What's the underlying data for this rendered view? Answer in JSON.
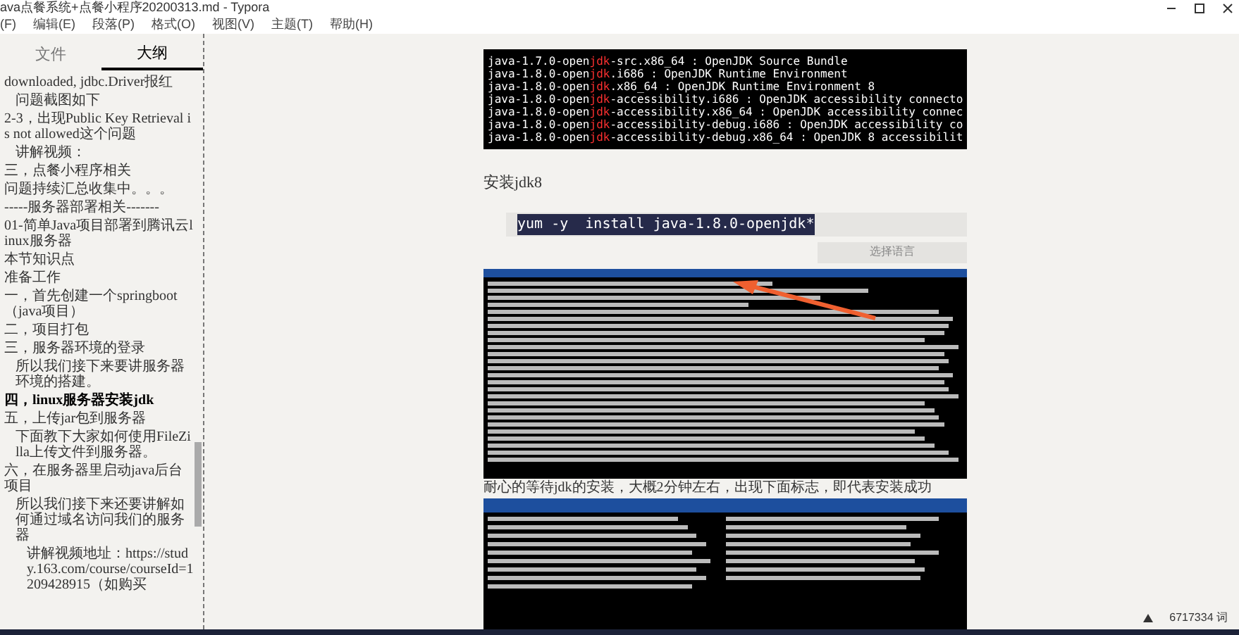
{
  "window": {
    "title": "ava点餐系统+点餐小程序20200313.md - Typora"
  },
  "menu": [
    "(F)",
    "编辑(E)",
    "段落(P)",
    "格式(O)",
    "视图(V)",
    "主题(T)",
    "帮助(H)"
  ],
  "sidebar": {
    "tabs": [
      {
        "label": "文件",
        "selected": false
      },
      {
        "label": "大纲",
        "selected": true
      }
    ],
    "items": [
      {
        "text": "downloaded, jdbc.Driver报红",
        "selected": false,
        "children": [
          {
            "text": "问题截图如下",
            "selected": false
          }
        ]
      },
      {
        "text": "2-3，出现Public Key Retrieval is not allowed这个问题",
        "selected": false,
        "children": [
          {
            "text": "讲解视频：",
            "selected": false
          }
        ]
      },
      {
        "text": "三，点餐小程序相关",
        "selected": false
      },
      {
        "text": "问题持续汇总收集中。。。",
        "selected": false
      },
      {
        "text": "-----服务器部署相关-------",
        "selected": false
      },
      {
        "text": "01-简单Java项目部署到腾讯云linux服务器",
        "selected": false
      },
      {
        "text": "本节知识点",
        "selected": false
      },
      {
        "text": "准备工作",
        "selected": false
      },
      {
        "text": "一，首先创建一个springboot（java项目）",
        "selected": false
      },
      {
        "text": "二，项目打包",
        "selected": false
      },
      {
        "text": "三，服务器环境的登录",
        "selected": false,
        "children": [
          {
            "text": "所以我们接下来要讲服务器环境的搭建。",
            "selected": false
          }
        ]
      },
      {
        "text": "四，linux服务器安装jdk",
        "selected": true
      },
      {
        "text": "五，上传jar包到服务器",
        "selected": false,
        "children": [
          {
            "text": "下面教下大家如何使用FileZilla上传文件到服务器。",
            "selected": false
          }
        ]
      },
      {
        "text": "六，在服务器里启动java后台项目",
        "selected": false,
        "children": [
          {
            "text": "所以我们接下来还要讲解如何通过域名访问我们的服务器",
            "selected": false,
            "children": [
              {
                "text": "讲解视频地址：https://study.163.com/course/courseId=1209428915（如购买",
                "selected": false
              }
            ]
          }
        ]
      }
    ]
  },
  "editor": {
    "terminal_lines": [
      {
        "before": "java-1.7.0-open",
        "match": "jdk",
        "after": "-src.x86_64 : OpenJDK Source Bundle"
      },
      {
        "before": "java-1.8.0-open",
        "match": "jdk",
        "after": ".i686 : OpenJDK Runtime Environment"
      },
      {
        "before": "java-1.8.0-open",
        "match": "jdk",
        "after": ".x86_64 : OpenJDK Runtime Environment 8"
      },
      {
        "before": "java-1.8.0-open",
        "match": "jdk",
        "after": "-accessibility.i686 : OpenJDK accessibility connecto"
      },
      {
        "before": "java-1.8.0-open",
        "match": "jdk",
        "after": "-accessibility.x86_64 : OpenJDK accessibility connec"
      },
      {
        "before": "java-1.8.0-open",
        "match": "jdk",
        "after": "-accessibility-debug.i686 : OpenJDK accessibility co"
      },
      {
        "before": "java-1.8.0-open",
        "match": "jdk",
        "after": "-accessibility-debug.x86_64 : OpenJDK 8 accessibilit"
      }
    ],
    "heading": "安装jdk8",
    "code": "yum -y  install java-1.8.0-openjdk*",
    "language_button": "选择语言",
    "caption": "耐心的等待jdk的安装，大概2分钟左右，出现下面标志，即代表安装成功"
  },
  "status_bar": {
    "word_count": "6717334 词"
  }
}
